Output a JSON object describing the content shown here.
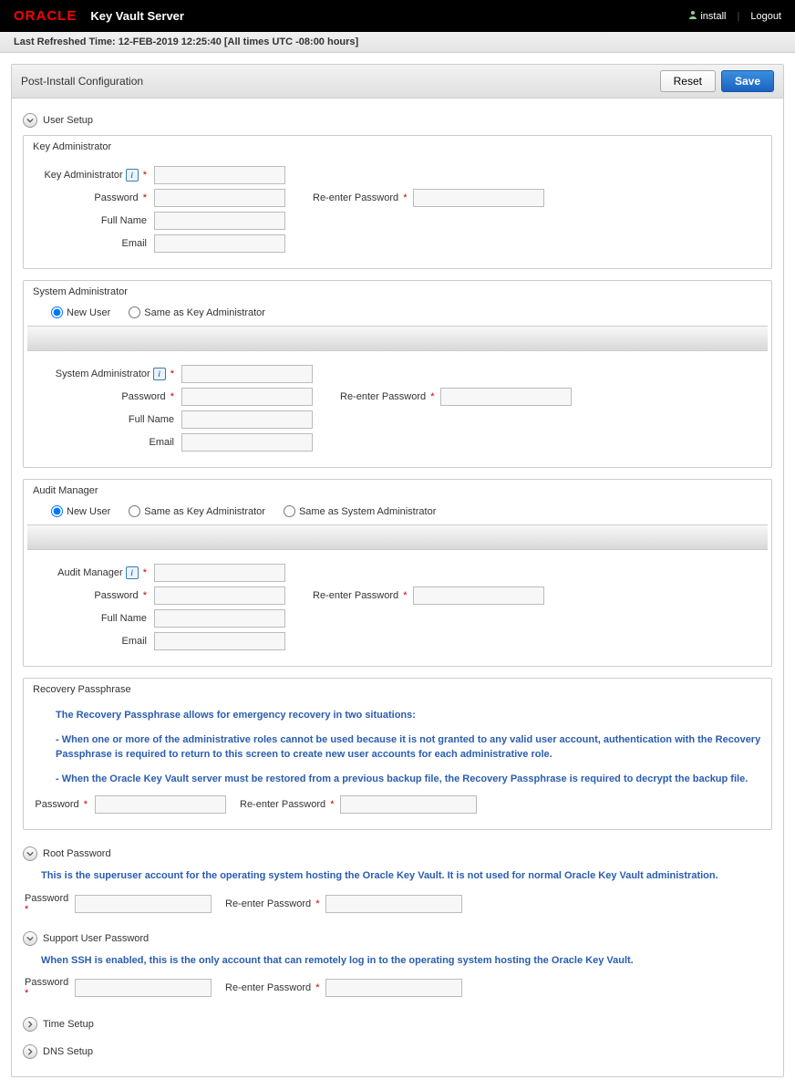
{
  "brand": {
    "oracle": "ORACLE",
    "product": "Key Vault Server"
  },
  "topbar": {
    "user": "install",
    "logout": "Logout"
  },
  "refresh": "Last Refreshed Time: 12-FEB-2019 12:25:40 [All times UTC -08:00 hours]",
  "panel": {
    "title": "Post-Install Configuration",
    "reset": "Reset",
    "save": "Save"
  },
  "sections": {
    "user_setup": "User Setup",
    "root_password": "Root Password",
    "support_user": "Support User Password",
    "time_setup": "Time Setup",
    "dns_setup": "DNS Setup"
  },
  "labels": {
    "password": "Password",
    "reenter": "Re-enter Password",
    "fullname": "Full Name",
    "email": "Email"
  },
  "key_admin": {
    "box_title": "Key Administrator",
    "label": "Key Administrator"
  },
  "sys_admin": {
    "box_title": "System Administrator",
    "label": "System Administrator",
    "radio_new": "New User",
    "radio_same_key": "Same as Key Administrator"
  },
  "audit": {
    "box_title": "Audit Manager",
    "label": "Audit Manager",
    "radio_new": "New User",
    "radio_same_key": "Same as Key Administrator",
    "radio_same_sys": "Same as System Administrator"
  },
  "recovery": {
    "title": "Recovery Passphrase",
    "line1": "The Recovery Passphrase allows for emergency recovery in two situations:",
    "line2": "- When one or more of the administrative roles cannot be used because it is not granted to any valid user account, authentication with the Recovery Passphrase is required to return to this screen to create new user accounts for each administrative role.",
    "line3": "- When the Oracle Key Vault server must be restored from a previous backup file, the Recovery Passphrase is required to decrypt the backup file."
  },
  "root": {
    "desc": "This is the superuser account for the operating system hosting the Oracle Key Vault. It is not used for normal Oracle Key Vault administration."
  },
  "support": {
    "desc": "When SSH is enabled, this is the only account that can remotely log in to the operating system hosting the Oracle Key Vault."
  }
}
